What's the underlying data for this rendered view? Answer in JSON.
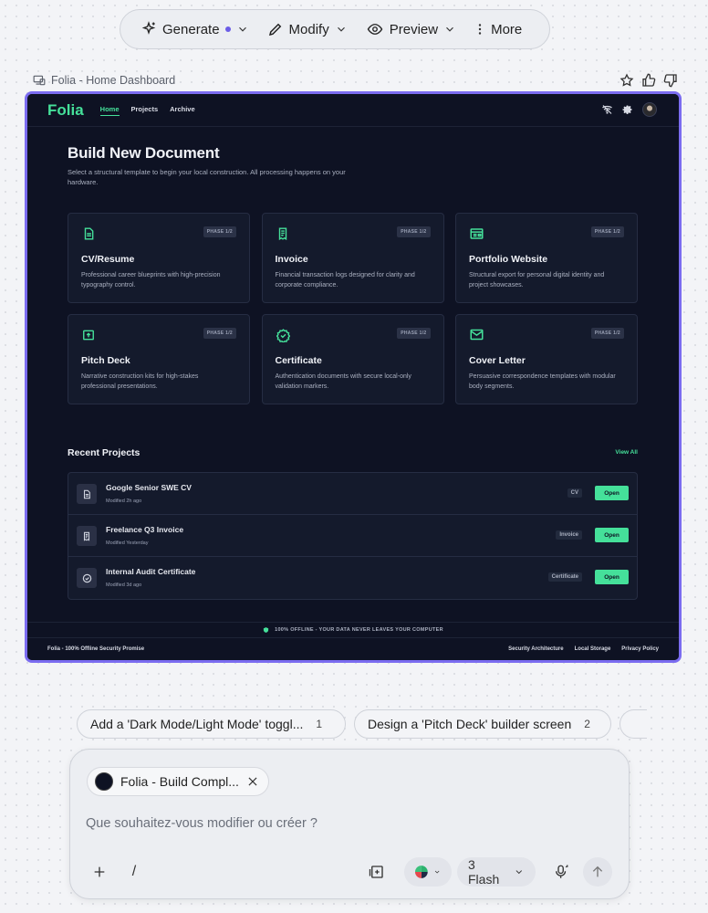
{
  "toolbar": {
    "generate": "Generate",
    "modify": "Modify",
    "preview": "Preview",
    "more": "More"
  },
  "frame": {
    "label": "Folia - Home Dashboard"
  },
  "app": {
    "logo": "Folia",
    "nav": [
      "Home",
      "Projects",
      "Archive"
    ],
    "hero_title": "Build New Document",
    "hero_subtitle": "Select a structural template to begin your local construction. All processing happens on your hardware.",
    "cards": [
      {
        "title": "CV/Resume",
        "badge": "PHASE 1/2",
        "desc": "Professional career blueprints with high-precision typography control.",
        "icon": "document-icon"
      },
      {
        "title": "Invoice",
        "badge": "PHASE 1/2",
        "desc": "Financial transaction logs designed for clarity and corporate compliance.",
        "icon": "receipt-icon"
      },
      {
        "title": "Portfolio Website",
        "badge": "PHASE 1/2",
        "desc": "Structural export for personal digital identity and project showcases.",
        "icon": "web-icon"
      },
      {
        "title": "Pitch Deck",
        "badge": "PHASE 1/2",
        "desc": "Narrative construction kits for high-stakes professional presentations.",
        "icon": "presentation-icon"
      },
      {
        "title": "Certificate",
        "badge": "PHASE 1/2",
        "desc": "Authentication documents with secure local-only validation markers.",
        "icon": "verified-icon"
      },
      {
        "title": "Cover Letter",
        "badge": "PHASE 1/2",
        "desc": "Persuasive correspondence templates with modular body segments.",
        "icon": "mail-icon"
      }
    ],
    "recent_title": "Recent Projects",
    "view_all": "View All",
    "recent": [
      {
        "name": "Google Senior SWE CV",
        "time": "Modified 2h ago",
        "tag": "CV",
        "open": "Open",
        "icon": "document-icon"
      },
      {
        "name": "Freelance Q3 Invoice",
        "time": "Modified Yesterday",
        "tag": "Invoice",
        "open": "Open",
        "icon": "receipt-icon"
      },
      {
        "name": "Internal Audit Certificate",
        "time": "Modified 3d ago",
        "tag": "Certificate",
        "open": "Open",
        "icon": "verified-icon"
      }
    ],
    "offline_text": "100% OFFLINE - YOUR DATA NEVER LEAVES YOUR COMPUTER",
    "footer_left": "Folia - 100% Offline Security Promise",
    "footer_links": [
      "Security Architecture",
      "Local Storage",
      "Privacy Policy"
    ]
  },
  "suggestions": [
    {
      "text": "Add a 'Dark Mode/Light Mode' toggl...",
      "num": "1"
    },
    {
      "text": "Design a 'Pitch Deck' builder screen",
      "num": "2"
    }
  ],
  "prompt": {
    "context_chip": "Folia - Build Compl...",
    "placeholder": "Que souhaitez-vous modifier ou créer ?",
    "slash": "/",
    "model": "3 Flash"
  },
  "colors": {
    "accent": "#45e09a",
    "frame_border": "#7b6cf0",
    "app_bg": "#0e1223",
    "card_bg": "#141a2c"
  }
}
